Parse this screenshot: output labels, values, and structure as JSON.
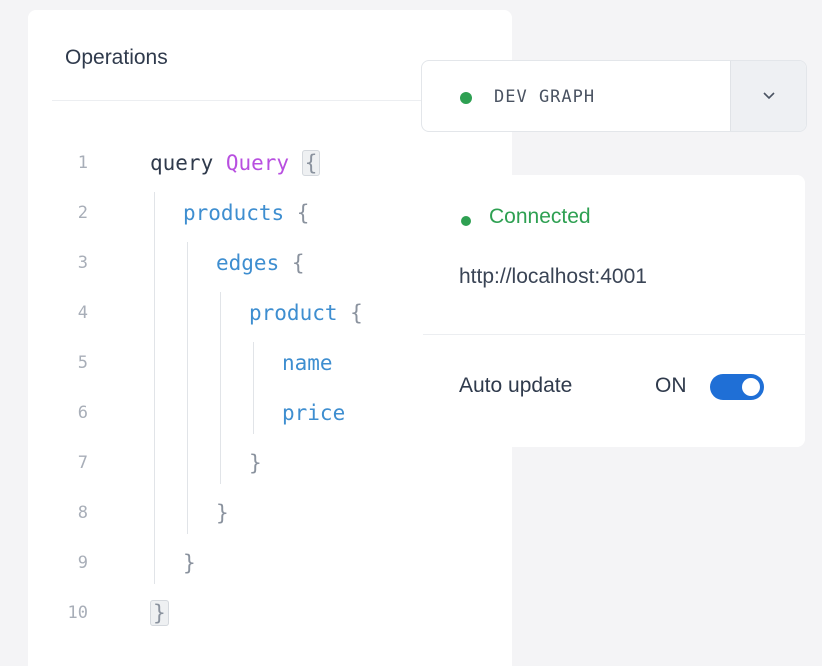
{
  "operations": {
    "title": "Operations",
    "lines": [
      {
        "num": "1",
        "parts": [
          {
            "t": "query ",
            "c": "kw"
          },
          {
            "t": "Query ",
            "c": "name"
          },
          {
            "t": "{",
            "c": "brace brace-hl"
          }
        ]
      },
      {
        "num": "2",
        "parts": [
          {
            "t": "products ",
            "c": "field"
          },
          {
            "t": "{",
            "c": "brace"
          }
        ]
      },
      {
        "num": "3",
        "parts": [
          {
            "t": "edges ",
            "c": "field"
          },
          {
            "t": "{",
            "c": "brace"
          }
        ]
      },
      {
        "num": "4",
        "parts": [
          {
            "t": "product ",
            "c": "field"
          },
          {
            "t": "{",
            "c": "brace"
          }
        ]
      },
      {
        "num": "5",
        "parts": [
          {
            "t": "name",
            "c": "field"
          }
        ]
      },
      {
        "num": "6",
        "parts": [
          {
            "t": "price",
            "c": "field"
          }
        ]
      },
      {
        "num": "7",
        "parts": [
          {
            "t": "}",
            "c": "brace"
          }
        ]
      },
      {
        "num": "8",
        "parts": [
          {
            "t": "}",
            "c": "brace"
          }
        ]
      },
      {
        "num": "9",
        "parts": [
          {
            "t": "}",
            "c": "brace"
          }
        ]
      },
      {
        "num": "10",
        "parts": [
          {
            "t": "}",
            "c": "brace brace-hl"
          }
        ]
      }
    ]
  },
  "graph_selector": {
    "label": "DEV GRAPH",
    "status_color": "#2ea052",
    "caret_icon": "chevron-down-icon"
  },
  "connection": {
    "status": "Connected",
    "status_color": "#2ea052",
    "url": "http://localhost:4001",
    "auto_update_label": "Auto update",
    "auto_update_state": "ON",
    "toggle_color": "#1f6fd6"
  }
}
